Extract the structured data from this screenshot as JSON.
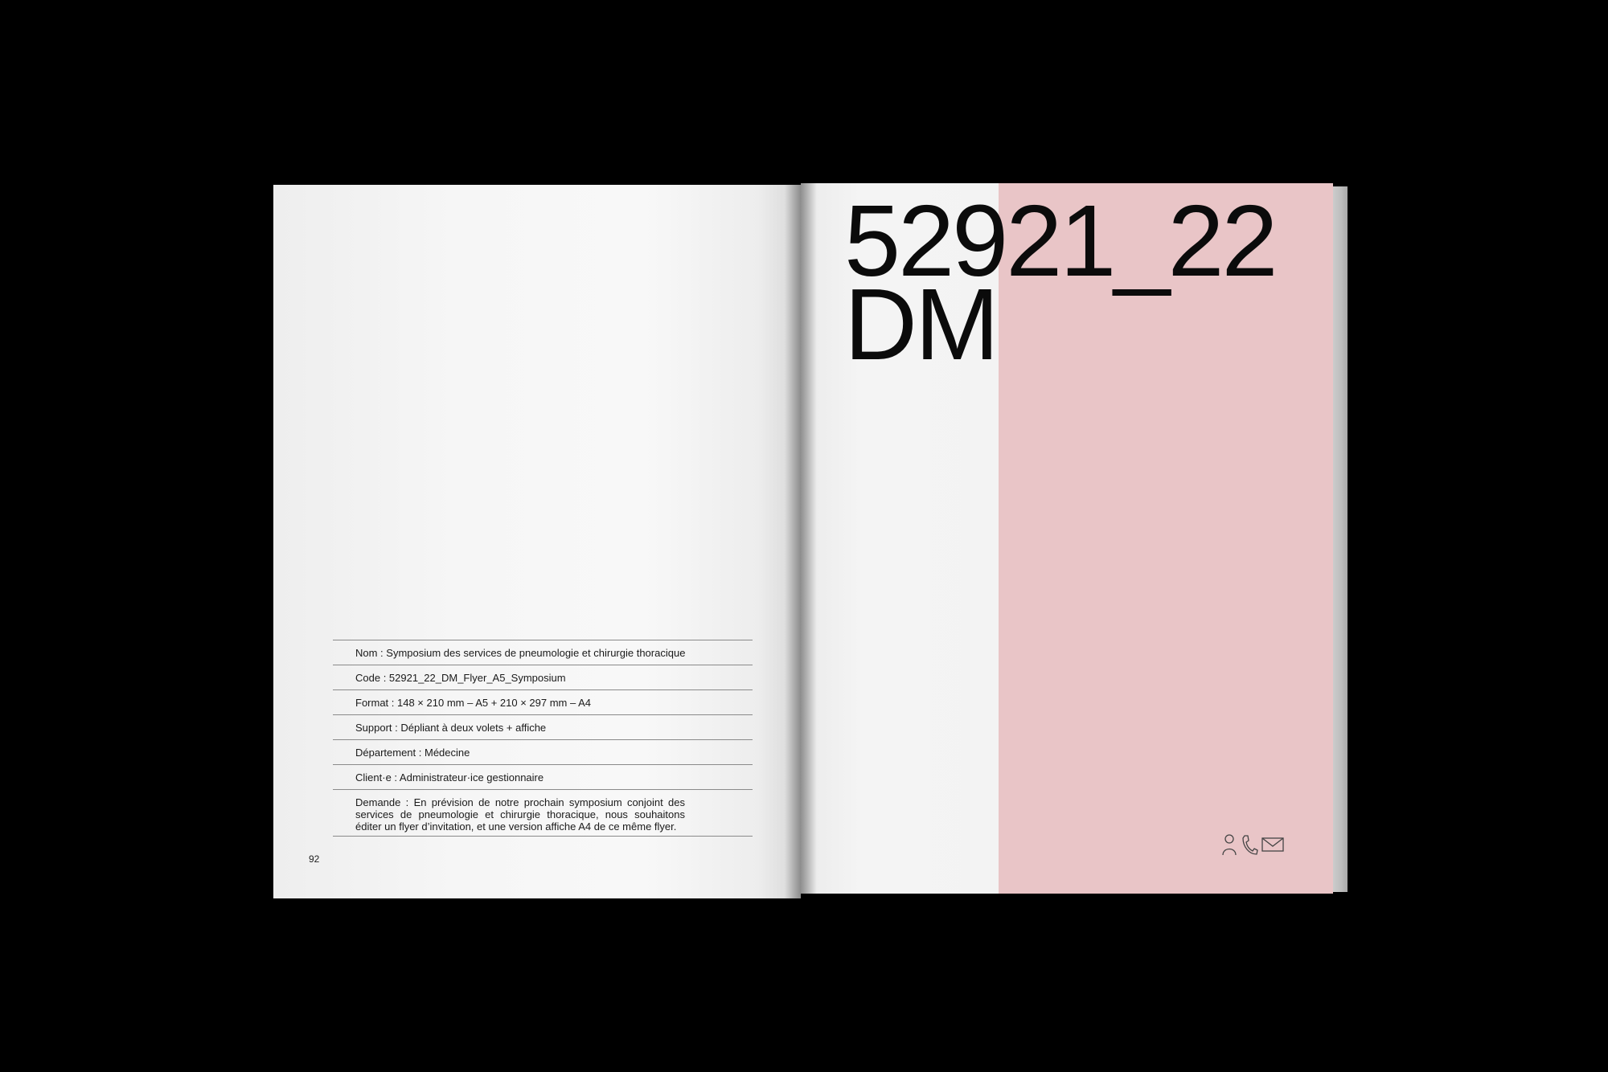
{
  "left_page": {
    "page_number": "92",
    "info_rows": [
      "Nom : Symposium des services de pneumologie et chirurgie thoracique",
      "Code : 52921_22_DM_Flyer_A5_Symposium",
      "Format : 148 × 210 mm – A5 + 210 × 297 mm – A4",
      "Support : Dépliant à deux volets + affiche",
      "Département : Médecine",
      "Client·e : Administrateur·ice gestionnaire",
      "Demande : En prévision de notre prochain symposium conjoint des services de pneumologie et chirurgie thoracique, nous souhaitons éditer un flyer d’invitation, et une version affiche A4 de ce même flyer."
    ]
  },
  "right_page": {
    "title_line1": "52921_22",
    "title_line2": "DM",
    "icons": [
      "person-icon",
      "phone-icon",
      "mail-icon"
    ]
  },
  "colors": {
    "background": "#000000",
    "paper": "#f4f4f4",
    "pink": "#e9c5c7",
    "text": "#0b0b0b"
  }
}
